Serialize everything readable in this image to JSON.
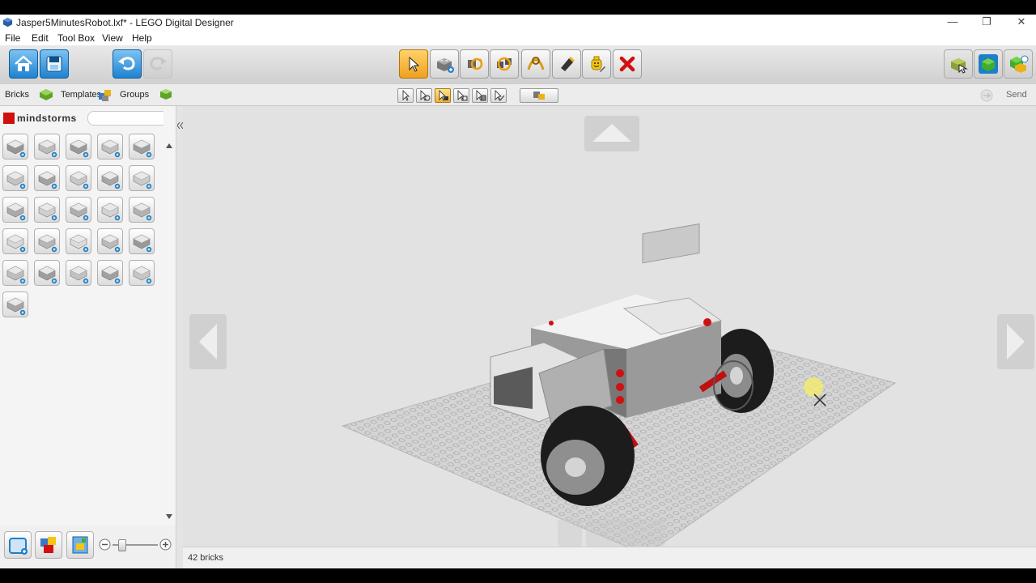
{
  "window": {
    "title": "Jasper5MinutesRobot.lxf* - LEGO Digital Designer",
    "controls": {
      "minimize": "—",
      "restore": "❐",
      "close": "✕"
    }
  },
  "menu": [
    "File",
    "Edit",
    "Tool Box",
    "View",
    "Help"
  ],
  "toolbar": {
    "left": [
      {
        "name": "home",
        "icon": "home-icon"
      },
      {
        "name": "save",
        "icon": "save-icon"
      },
      {
        "name": "undo",
        "icon": "undo-icon"
      },
      {
        "name": "redo",
        "icon": "redo-icon"
      }
    ],
    "tools": [
      {
        "name": "select",
        "icon": "arrow-cursor-icon",
        "active": true
      },
      {
        "name": "clone",
        "icon": "clone-brick-icon"
      },
      {
        "name": "hinge",
        "icon": "hinge-icon"
      },
      {
        "name": "hinge-align",
        "icon": "hinge-align-icon"
      },
      {
        "name": "flex",
        "icon": "flex-icon"
      },
      {
        "name": "paint",
        "icon": "paint-bucket-icon"
      },
      {
        "name": "decorate",
        "icon": "minifig-head-icon"
      },
      {
        "name": "delete",
        "icon": "red-x-icon"
      }
    ],
    "right": [
      {
        "name": "build-mode",
        "icon": "build-mode-icon"
      },
      {
        "name": "view-mode",
        "icon": "view-mode-icon"
      },
      {
        "name": "building-guide",
        "icon": "building-guide-icon"
      }
    ]
  },
  "tabs": [
    {
      "label": "Bricks"
    },
    {
      "label": "Templates"
    },
    {
      "label": "Groups"
    }
  ],
  "send_label": "Send",
  "palette": {
    "brand": "mindstorms",
    "search_placeholder": "",
    "brick_count_in_palette": 26
  },
  "status": {
    "brick_count": "42 bricks"
  },
  "colors": {
    "accent_orange": "#f0a020",
    "delete_red": "#d01010",
    "brand_red": "#d01010"
  }
}
